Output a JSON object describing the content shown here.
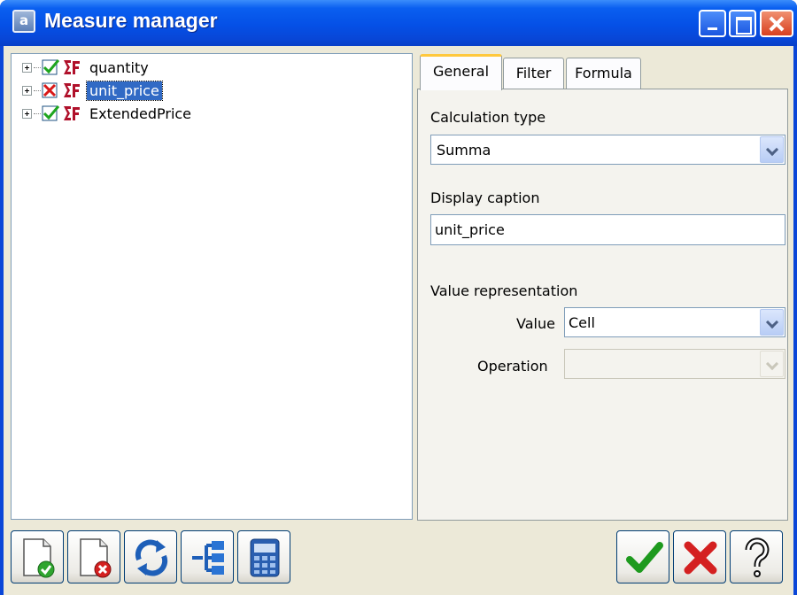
{
  "window": {
    "icon_letter": "a",
    "title": "Measure manager"
  },
  "tree": {
    "items": [
      {
        "label": "quantity",
        "checked": true,
        "selected": false
      },
      {
        "label": "unit_price",
        "checked": false,
        "selected": true
      },
      {
        "label": "ExtendedPrice",
        "checked": true,
        "selected": false
      }
    ]
  },
  "tabs": [
    {
      "label": "General",
      "active": true
    },
    {
      "label": "Filter",
      "active": false
    },
    {
      "label": "Formula",
      "active": false
    }
  ],
  "general": {
    "calc_type_label": "Calculation type",
    "calc_type_value": "Summa",
    "display_caption_label": "Display caption",
    "display_caption_value": "unit_price",
    "value_repr_label": "Value representation",
    "value_label": "Value",
    "value_value": "Cell",
    "operation_label": "Operation",
    "operation_value": ""
  },
  "toolbar": {
    "left_buttons": [
      "new-measure-icon",
      "delete-measure-icon",
      "refresh-icon",
      "hierarchy-icon",
      "calculator-icon"
    ],
    "right_buttons": [
      "ok-check-icon",
      "cancel-x-icon",
      "help-question-icon"
    ]
  },
  "colors": {
    "title_bar": "#0550e6",
    "selection": "#316ac5",
    "active_tab_accent": "#ffc83c",
    "check_green": "#1ea51e",
    "cross_red": "#d81818"
  }
}
